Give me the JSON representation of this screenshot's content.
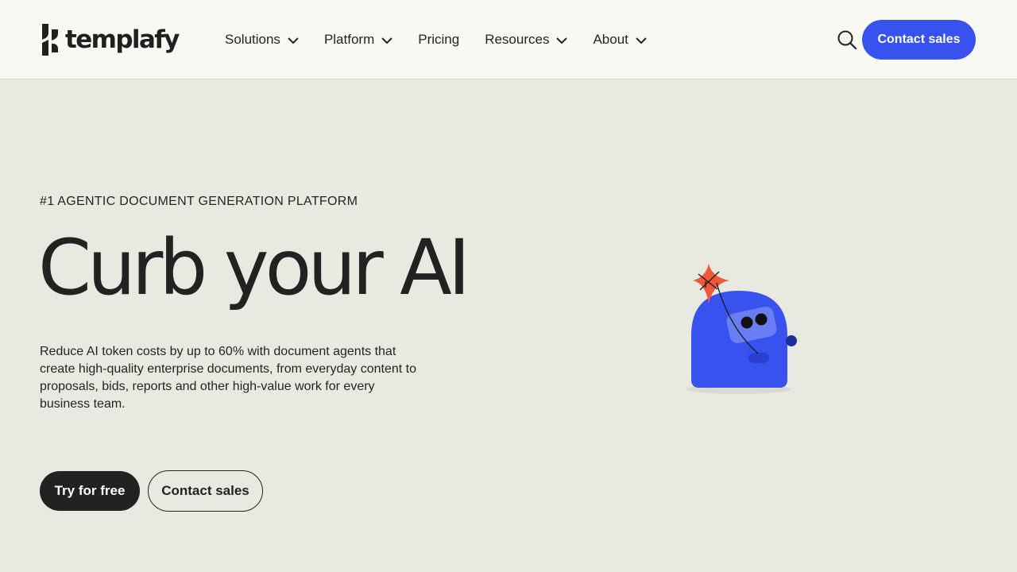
{
  "header": {
    "logo_text": "templafy",
    "nav": [
      {
        "label": "Solutions",
        "has_menu": true
      },
      {
        "label": "Platform",
        "has_menu": true
      },
      {
        "label": "Pricing",
        "has_menu": false
      },
      {
        "label": "Resources",
        "has_menu": true
      },
      {
        "label": "About",
        "has_menu": true
      }
    ],
    "search_icon": "search-icon",
    "contact_label": "Contact sales"
  },
  "hero": {
    "eyebrow": "#1 AGENTIC DOCUMENT GENERATION PLATFORM",
    "title": "Curb your AI",
    "description": "Reduce AI token costs by up to 60% with document agents that create high-quality enterprise documents, from everyday content to proposals, bids, reports and other high-value work for every business team.",
    "primary_cta": "Try for free",
    "secondary_cta": "Contact sales",
    "illustration": "robot-kite-illustration"
  },
  "colors": {
    "accent": "#3852f0",
    "header_bg": "#f7f9f2",
    "page_bg": "#e8eae2",
    "dark": "#222222",
    "spark": "#f0593a"
  }
}
